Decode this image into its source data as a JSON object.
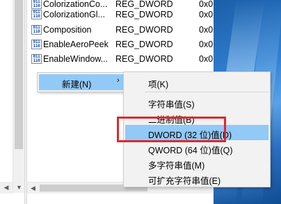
{
  "registry_values": [
    {
      "name": "ColorizationCo...",
      "type": "REG_DWORD",
      "data": "0x0",
      "icon": "binary-value-icon"
    },
    {
      "name": "ColorizationGl...",
      "type": "REG_DWORD",
      "data": "0x0",
      "icon": "binary-value-icon"
    },
    {
      "name": "Composition",
      "type": "REG_DWORD",
      "data": "0x0",
      "icon": "binary-value-icon"
    },
    {
      "name": "EnableAeroPeek",
      "type": "REG_DWORD",
      "data": "0x0",
      "icon": "binary-value-icon"
    },
    {
      "name": "EnableWindow...",
      "type": "REG_DWORD",
      "data": "0x0",
      "icon": "binary-value-icon"
    }
  ],
  "icon_glyph": "011\n110",
  "context_menu": {
    "new_label": "新建(N)",
    "arrow": "›"
  },
  "submenu": {
    "items": [
      {
        "label": "项(K)"
      },
      {
        "label": "字符串值(S)"
      },
      {
        "label": "二进制值(B)"
      },
      {
        "label": "DWORD (32 位)值(D)",
        "highlighted": true
      },
      {
        "label": "QWORD (64 位)值(Q)"
      },
      {
        "label": "多字符串值(M)"
      },
      {
        "label": "可扩充字符串值(E)"
      }
    ]
  },
  "colors": {
    "menu_highlight": "#91c9f7",
    "annotation_box": "#e0282b"
  }
}
